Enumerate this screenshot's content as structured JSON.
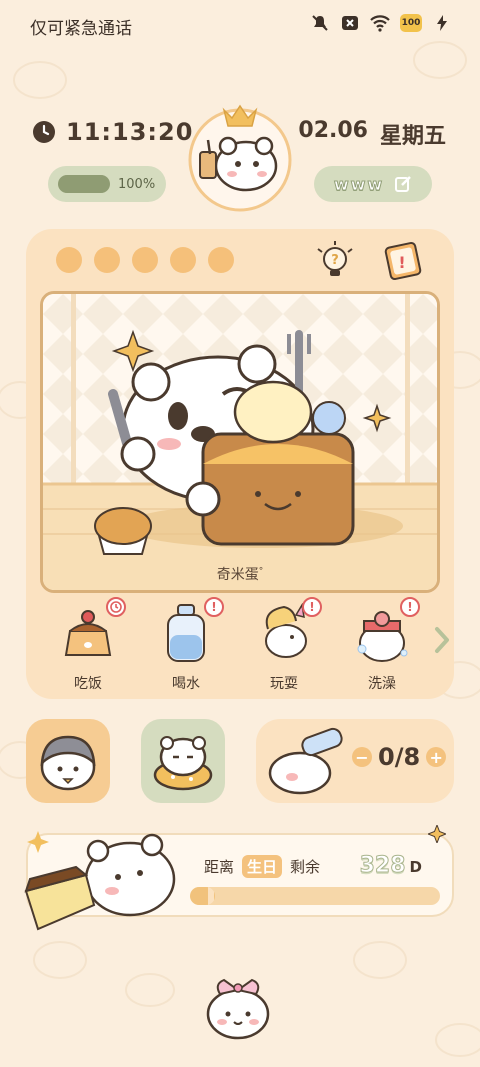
{
  "status_bar": {
    "carrier_text": "仅可紧急通话",
    "battery_level": "100",
    "icons": [
      "mute-icon",
      "no-sim-icon",
      "wifi-icon",
      "battery-icon",
      "charging-icon"
    ]
  },
  "header": {
    "time": "11:13:20",
    "date": "02.06",
    "weekday": "星期五",
    "battery_widget": {
      "percent_text": "100%",
      "level": 1.0
    },
    "nickname_widget": {
      "text": "www"
    }
  },
  "pet_card": {
    "stamina_dots": 5,
    "pet_name": "奇米蛋",
    "name_suffix": "°",
    "actions": [
      {
        "label": "吃饭",
        "badge": "clock",
        "icon": "pudding-icon"
      },
      {
        "label": "喝水",
        "badge": "!",
        "icon": "water-bottle-icon"
      },
      {
        "label": "玩耍",
        "badge": "!",
        "icon": "unicorn-toy-icon"
      },
      {
        "label": "洗澡",
        "badge": "!",
        "icon": "bath-icon"
      }
    ]
  },
  "water_widget": {
    "value": "0/8",
    "minus": "−",
    "plus": "+"
  },
  "birthday_widget": {
    "prefix": "距离",
    "highlight": "生日",
    "suffix": "剩余",
    "days": "328",
    "unit": "D",
    "progress": 0.1
  },
  "colors": {
    "accent": "#f4c27e",
    "green": "#d5dcbf",
    "bg": "#fbeedd"
  }
}
